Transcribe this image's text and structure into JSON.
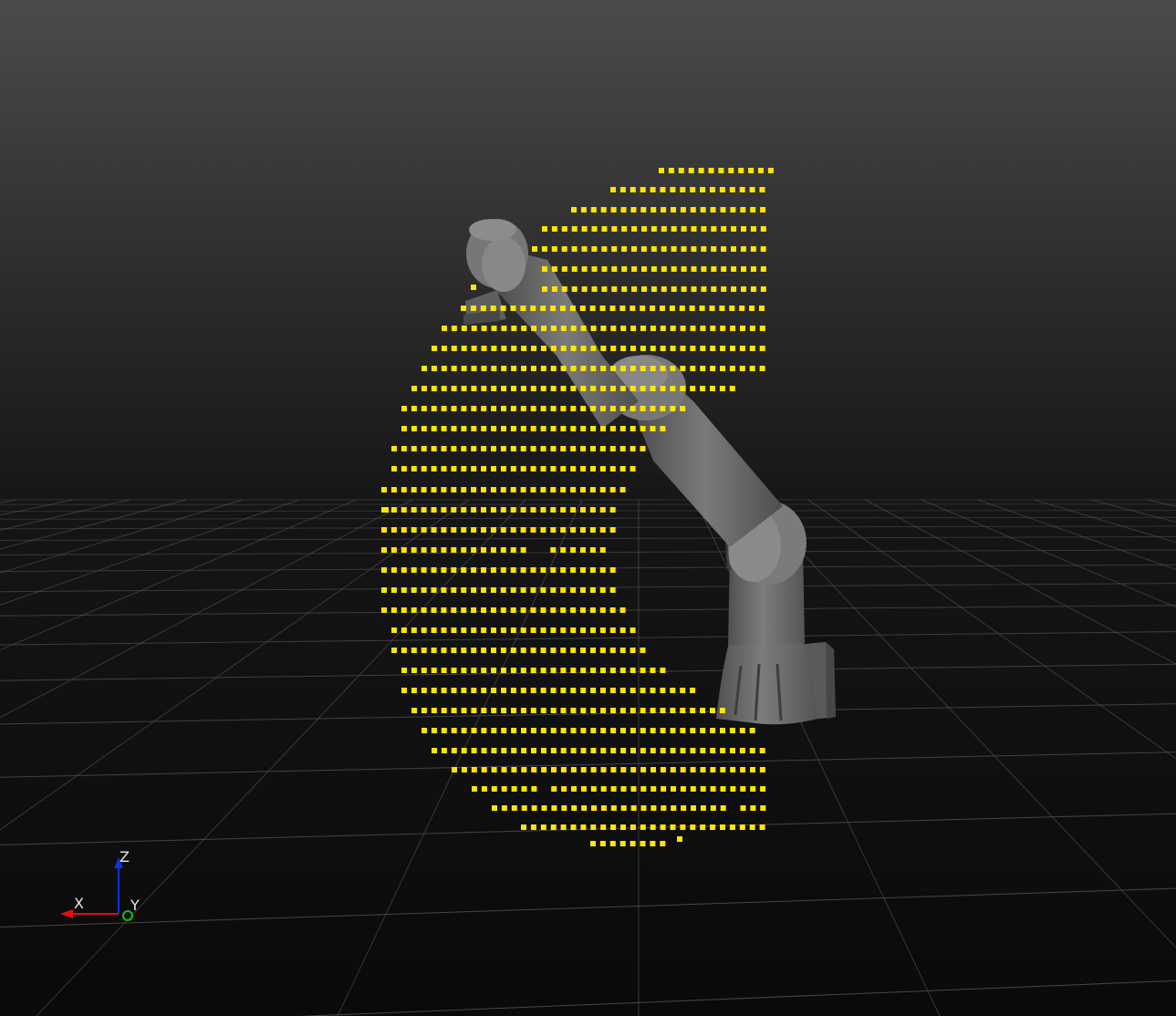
{
  "viewer": {
    "background_top": "#4b4b4b",
    "background_bottom": "#0a0a0a",
    "grid_color": "#5a5a5a",
    "robot_color": "#6e6e6e",
    "point_color": "#ffe600"
  },
  "axes_gizmo": {
    "x_label": "X",
    "y_label": "Y",
    "z_label": "Z",
    "x_color": "#e01010",
    "y_color": "#10c010",
    "z_color": "#1030e0"
  },
  "icons": {
    "robot": "robot-arm-icon",
    "axes": "axes-gizmo-icon"
  }
}
